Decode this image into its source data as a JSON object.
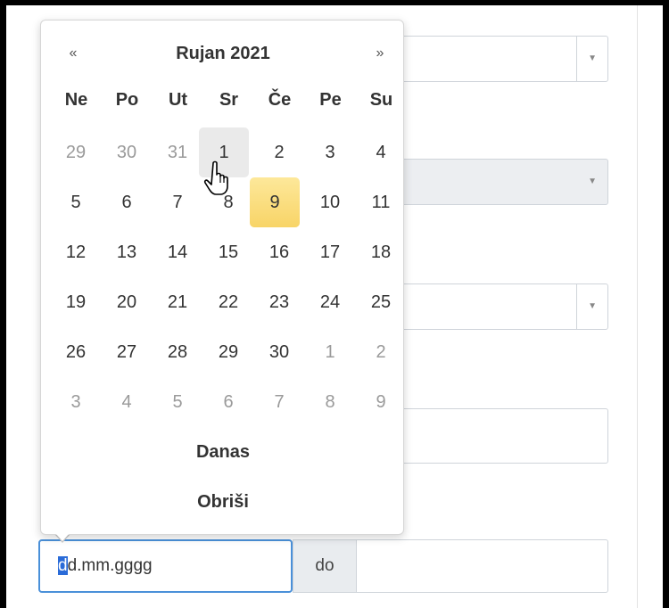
{
  "form": {
    "date_from_placeholder_first": "d",
    "date_from_placeholder_rest": "d.mm.gggg",
    "to_label": "do"
  },
  "select_caret_icon": "▼",
  "datepicker": {
    "prev": "«",
    "next": "»",
    "title": "Rujan 2021",
    "weekdays": [
      "Ne",
      "Po",
      "Ut",
      "Sr",
      "Če",
      "Pe",
      "Su"
    ],
    "weeks": [
      [
        "29",
        "30",
        "31",
        "1",
        "2",
        "3",
        "4"
      ],
      [
        "5",
        "6",
        "7",
        "8",
        "9",
        "10",
        "11"
      ],
      [
        "12",
        "13",
        "14",
        "15",
        "16",
        "17",
        "18"
      ],
      [
        "19",
        "20",
        "21",
        "22",
        "23",
        "24",
        "25"
      ],
      [
        "26",
        "27",
        "28",
        "29",
        "30",
        "1",
        "2"
      ],
      [
        "3",
        "4",
        "5",
        "6",
        "7",
        "8",
        "9"
      ]
    ],
    "today_button": "Danas",
    "clear_button": "Obriši",
    "highlight_color": "#f8d467",
    "hover_color": "#eaeaea"
  }
}
